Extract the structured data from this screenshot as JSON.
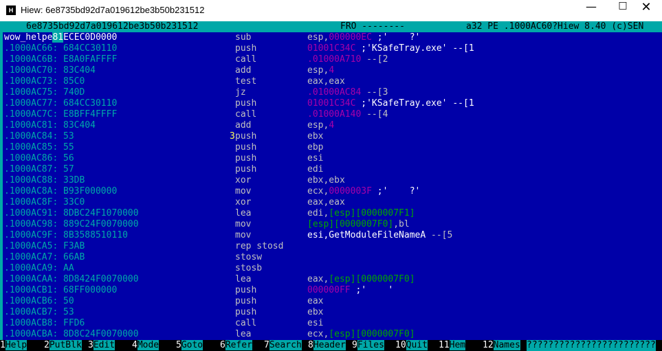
{
  "window": {
    "title": "Hiew: 6e8735bd92d7a019612be3b50b231512",
    "app_icon_label": "H",
    "minimize_icon": "minimize-icon",
    "maximize_icon": "maximize-icon",
    "close_icon": "close-icon"
  },
  "status": {
    "file": "6e8735bd92d7a019612be3b50b231512",
    "mode": "FRO --------",
    "info": "a32 PE .1000AC60?Hiew 8.40 (c)SEN"
  },
  "disasm": [
    {
      "addr_a": "wow_helpe",
      "addr_hl": "81",
      "addr_b": "ECEC0D0000",
      "mnemonic": "sub",
      "op": [
        {
          "t": "esp,",
          "c": "plain"
        },
        {
          "t": "000000EC",
          "c": "num"
        },
        {
          "t": " ;'    ?'",
          "c": "cmt"
        }
      ]
    },
    {
      "addr": ".1000AC66:",
      "bytes": "684CC30110",
      "mnemonic": "push",
      "op": [
        {
          "t": "01001C34C",
          "c": "num"
        },
        {
          "t": " ;'KSafeTray.exe' --[1",
          "c": "cmt"
        }
      ]
    },
    {
      "addr": ".1000AC6B:",
      "bytes": "E8A0FAFFFF",
      "mnemonic": "call",
      "op": [
        {
          "t": ".01000A710",
          "c": "num"
        },
        {
          "t": " --[2",
          "c": "ref"
        }
      ]
    },
    {
      "addr": ".1000AC70:",
      "bytes": "83C404",
      "mnemonic": "add",
      "op": [
        {
          "t": "esp,",
          "c": "plain"
        },
        {
          "t": "4",
          "c": "num"
        }
      ]
    },
    {
      "addr": ".1000AC73:",
      "bytes": "85C0",
      "mnemonic": "test",
      "op": [
        {
          "t": "eax,eax",
          "c": "plain"
        }
      ]
    },
    {
      "addr": ".1000AC75:",
      "bytes": "740D",
      "mnemonic": "jz",
      "op": [
        {
          "t": ".01000AC84",
          "c": "num"
        },
        {
          "t": " --[3",
          "c": "ref"
        }
      ]
    },
    {
      "addr": ".1000AC77:",
      "bytes": "684CC30110",
      "mnemonic": "push",
      "op": [
        {
          "t": "01001C34C",
          "c": "num"
        },
        {
          "t": " ;'KSafeTray.exe' --[1",
          "c": "cmt"
        }
      ]
    },
    {
      "addr": ".1000AC7C:",
      "bytes": "E8BFF4FFFF",
      "mnemonic": "call",
      "op": [
        {
          "t": ".01000A140",
          "c": "num"
        },
        {
          "t": " --[4",
          "c": "ref"
        }
      ]
    },
    {
      "addr": ".1000AC81:",
      "bytes": "83C404",
      "mnemonic": "add",
      "op": [
        {
          "t": "esp,",
          "c": "plain"
        },
        {
          "t": "4",
          "c": "num"
        }
      ]
    },
    {
      "addr": ".1000AC84:",
      "bytes": "53",
      "marker": "3",
      "mnemonic": "push",
      "op": [
        {
          "t": "ebx",
          "c": "plain"
        }
      ]
    },
    {
      "addr": ".1000AC85:",
      "bytes": "55",
      "mnemonic": "push",
      "op": [
        {
          "t": "ebp",
          "c": "plain"
        }
      ]
    },
    {
      "addr": ".1000AC86:",
      "bytes": "56",
      "mnemonic": "push",
      "op": [
        {
          "t": "esi",
          "c": "plain"
        }
      ]
    },
    {
      "addr": ".1000AC87:",
      "bytes": "57",
      "mnemonic": "push",
      "op": [
        {
          "t": "edi",
          "c": "plain"
        }
      ]
    },
    {
      "addr": ".1000AC88:",
      "bytes": "33DB",
      "mnemonic": "xor",
      "op": [
        {
          "t": "ebx,ebx",
          "c": "plain"
        }
      ]
    },
    {
      "addr": ".1000AC8A:",
      "bytes": "B93F000000",
      "mnemonic": "mov",
      "op": [
        {
          "t": "ecx,",
          "c": "plain"
        },
        {
          "t": "0000003F",
          "c": "num"
        },
        {
          "t": " ;'    ?'",
          "c": "cmt"
        }
      ]
    },
    {
      "addr": ".1000AC8F:",
      "bytes": "33C0",
      "mnemonic": "xor",
      "op": [
        {
          "t": "eax,eax",
          "c": "plain"
        }
      ]
    },
    {
      "addr": ".1000AC91:",
      "bytes": "8DBC24F1070000",
      "mnemonic": "lea",
      "op": [
        {
          "t": "edi,",
          "c": "plain"
        },
        {
          "t": "[esp][0000007F1]",
          "c": "mem"
        }
      ]
    },
    {
      "addr": ".1000AC98:",
      "bytes": "889C24F0070000",
      "mnemonic": "mov",
      "op": [
        {
          "t": "[esp][0000007F0]",
          "c": "mem"
        },
        {
          "t": ",bl",
          "c": "plain"
        }
      ]
    },
    {
      "addr": ".1000AC9F:",
      "bytes": "8B3588510110",
      "mnemonic": "mov",
      "op": [
        {
          "t": "esi,GetModuleFileNameA",
          "c": "cmt"
        },
        {
          "t": " --[5",
          "c": "ref"
        }
      ]
    },
    {
      "addr": ".1000ACA5:",
      "bytes": "F3AB",
      "mnemonic": "rep stosd",
      "op": []
    },
    {
      "addr": ".1000ACA7:",
      "bytes": "66AB",
      "mnemonic": "stosw",
      "op": []
    },
    {
      "addr": ".1000ACA9:",
      "bytes": "AA",
      "mnemonic": "stosb",
      "op": []
    },
    {
      "addr": ".1000ACAA:",
      "bytes": "8D8424F0070000",
      "mnemonic": "lea",
      "op": [
        {
          "t": "eax,",
          "c": "plain"
        },
        {
          "t": "[esp][0000007F0]",
          "c": "mem"
        }
      ]
    },
    {
      "addr": ".1000ACB1:",
      "bytes": "68FF000000",
      "mnemonic": "push",
      "op": [
        {
          "t": "000000FF",
          "c": "num"
        },
        {
          "t": " ;'    '",
          "c": "cmt"
        }
      ]
    },
    {
      "addr": ".1000ACB6:",
      "bytes": "50",
      "mnemonic": "push",
      "op": [
        {
          "t": "eax",
          "c": "plain"
        }
      ]
    },
    {
      "addr": ".1000ACB7:",
      "bytes": "53",
      "mnemonic": "push",
      "op": [
        {
          "t": "ebx",
          "c": "plain"
        }
      ]
    },
    {
      "addr": ".1000ACB8:",
      "bytes": "FFD6",
      "mnemonic": "call",
      "op": [
        {
          "t": "esi",
          "c": "plain"
        }
      ]
    },
    {
      "addr": ".1000ACBA:",
      "bytes": "8D8C24F0070000",
      "mnemonic": "lea",
      "op": [
        {
          "t": "ecx,",
          "c": "plain"
        },
        {
          "t": "[esp][0000007F0]",
          "c": "mem"
        }
      ]
    }
  ],
  "fkeys": [
    {
      "num": "1",
      "label": "Help"
    },
    {
      "num": "2",
      "label": "PutBlk"
    },
    {
      "num": "3",
      "label": "Edit"
    },
    {
      "num": "4",
      "label": "Mode"
    },
    {
      "num": "5",
      "label": "Goto"
    },
    {
      "num": "6",
      "label": "Refer"
    },
    {
      "num": "7",
      "label": "Search"
    },
    {
      "num": "8",
      "label": "Header"
    },
    {
      "num": "9",
      "label": "Files"
    },
    {
      "num": "10",
      "label": "Quit"
    },
    {
      "num": "11",
      "label": "Hem"
    },
    {
      "num": "12",
      "label": "Names"
    }
  ],
  "fkeys_tail": "????????????????????????",
  "colors": {
    "background": "#0000a8",
    "cyan": "#00a8a8",
    "immediate": "#a800a8",
    "memory": "#00a800"
  }
}
